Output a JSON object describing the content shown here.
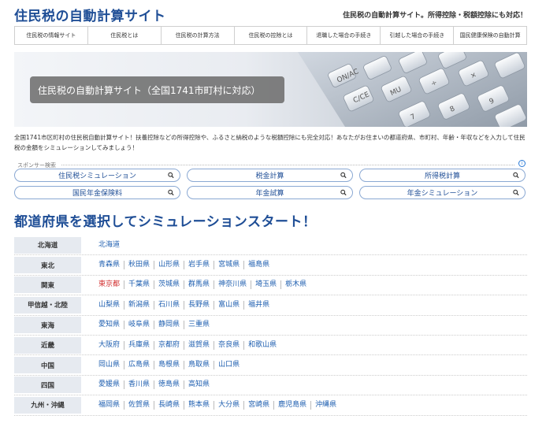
{
  "header": {
    "title": "住民税の自動計算サイト",
    "tagline": "住民税の自動計算サイト。所得控除・税額控除にも対応！"
  },
  "nav": [
    "住民税の情報サイト",
    "住民税とは",
    "住民税の計算方法",
    "住民税の控除とは",
    "退職した場合の手続き",
    "引越した場合の手続き",
    "国民健康保険の自動計算"
  ],
  "hero": {
    "caption": "住民税の自動計算サイト（全国1741市町村に対応）"
  },
  "intro": "全国1741市区町村の住民税自動計算サイト！扶養控除などの所得控除や、ふるさと納税のような税額控除にも完全対応！あなたがお住まいの都道府県、市町村、年齢・年収などを入力して住民税の金額をシミュレーションしてみましょう！",
  "sponsor": {
    "label": "スポンサー検索",
    "items": [
      "住民税シミュレーション",
      "税金計算",
      "所得税計算",
      "国民年金保険料",
      "年金試算",
      "年金シミュレーション"
    ]
  },
  "section_title": "都道府県を選択してシミュレーションスタート！",
  "regions": [
    {
      "name": "北海道",
      "prefs": [
        "北海道"
      ]
    },
    {
      "name": "東北",
      "prefs": [
        "青森県",
        "秋田県",
        "山形県",
        "岩手県",
        "宮城県",
        "福島県"
      ]
    },
    {
      "name": "関東",
      "prefs": [
        "東京都",
        "千葉県",
        "茨城県",
        "群馬県",
        "神奈川県",
        "埼玉県",
        "栃木県"
      ]
    },
    {
      "name": "甲信越・北陸",
      "prefs": [
        "山梨県",
        "新潟県",
        "石川県",
        "長野県",
        "富山県",
        "福井県"
      ]
    },
    {
      "name": "東海",
      "prefs": [
        "愛知県",
        "岐阜県",
        "静岡県",
        "三重県"
      ]
    },
    {
      "name": "近畿",
      "prefs": [
        "大阪府",
        "兵庫県",
        "京都府",
        "滋賀県",
        "奈良県",
        "和歌山県"
      ]
    },
    {
      "name": "中国",
      "prefs": [
        "岡山県",
        "広島県",
        "島根県",
        "鳥取県",
        "山口県"
      ]
    },
    {
      "name": "四国",
      "prefs": [
        "愛媛県",
        "香川県",
        "徳島県",
        "高知県"
      ]
    },
    {
      "name": "九州・沖縄",
      "prefs": [
        "福岡県",
        "佐賀県",
        "長崎県",
        "熊本県",
        "大分県",
        "宮崎県",
        "鹿児島県",
        "沖縄県"
      ]
    }
  ],
  "colors": {
    "brand": "#1f4e96",
    "link": "#1f5fb0",
    "highlight": "#d23030",
    "region_label_bg": "#e6eaf0"
  }
}
